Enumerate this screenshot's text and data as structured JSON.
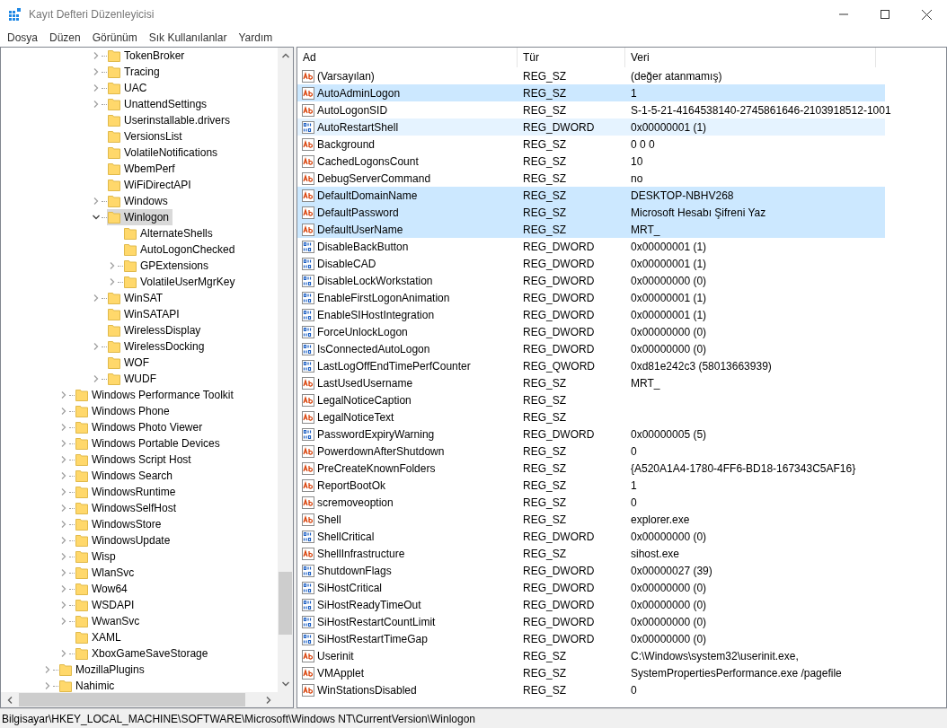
{
  "window": {
    "title": "Kayıt Defteri Düzenleyicisi"
  },
  "menu": [
    "Dosya",
    "Düzen",
    "Görünüm",
    "Sık Kullanılanlar",
    "Yardım"
  ],
  "tree": [
    {
      "children": [
        {
          "children": [
            {
              "children": [
                {
                  "name": "TokenBroker",
                  "expandable": true,
                  "selected": false
                },
                {
                  "name": "Tracing",
                  "expandable": true,
                  "selected": false
                },
                {
                  "name": "UAC",
                  "expandable": true,
                  "selected": false
                },
                {
                  "name": "UnattendSettings",
                  "expandable": true,
                  "selected": false
                },
                {
                  "name": "Userinstallable.drivers",
                  "expandable": false,
                  "selected": false
                },
                {
                  "name": "VersionsList",
                  "expandable": false,
                  "selected": false
                },
                {
                  "name": "VolatileNotifications",
                  "expandable": false,
                  "selected": false
                },
                {
                  "name": "WbemPerf",
                  "expandable": false,
                  "selected": false
                },
                {
                  "name": "WiFiDirectAPI",
                  "expandable": false,
                  "selected": false
                },
                {
                  "name": "Windows",
                  "expandable": true,
                  "selected": false
                },
                {
                  "name": "Winlogon",
                  "expandable": true,
                  "selected": true,
                  "children": [
                    {
                      "name": "AlternateShells",
                      "expandable": false,
                      "selected": false
                    },
                    {
                      "name": "AutoLogonChecked",
                      "expandable": false,
                      "selected": false
                    },
                    {
                      "name": "GPExtensions",
                      "expandable": true,
                      "selected": false
                    },
                    {
                      "name": "VolatileUserMgrKey",
                      "expandable": true,
                      "selected": false
                    }
                  ]
                },
                {
                  "name": "WinSAT",
                  "expandable": true,
                  "selected": false
                },
                {
                  "name": "WinSATAPI",
                  "expandable": false,
                  "selected": false
                },
                {
                  "name": "WirelessDisplay",
                  "expandable": false,
                  "selected": false
                },
                {
                  "name": "WirelessDocking",
                  "expandable": true,
                  "selected": false
                },
                {
                  "name": "WOF",
                  "expandable": false,
                  "selected": false
                },
                {
                  "name": "WUDF",
                  "expandable": true,
                  "selected": false
                }
              ]
            }
          ]
        },
        {
          "name": "Windows Performance Toolkit",
          "expandable": true,
          "selected": false
        },
        {
          "name": "Windows Phone",
          "expandable": true,
          "selected": false
        },
        {
          "name": "Windows Photo Viewer",
          "expandable": true,
          "selected": false
        },
        {
          "name": "Windows Portable Devices",
          "expandable": true,
          "selected": false
        },
        {
          "name": "Windows Script Host",
          "expandable": true,
          "selected": false
        },
        {
          "name": "Windows Search",
          "expandable": true,
          "selected": false
        },
        {
          "name": "WindowsRuntime",
          "expandable": true,
          "selected": false
        },
        {
          "name": "WindowsSelfHost",
          "expandable": true,
          "selected": false
        },
        {
          "name": "WindowsStore",
          "expandable": true,
          "selected": false
        },
        {
          "name": "WindowsUpdate",
          "expandable": true,
          "selected": false
        },
        {
          "name": "Wisp",
          "expandable": true,
          "selected": false
        },
        {
          "name": "WlanSvc",
          "expandable": true,
          "selected": false
        },
        {
          "name": "Wow64",
          "expandable": true,
          "selected": false
        },
        {
          "name": "WSDAPI",
          "expandable": true,
          "selected": false
        },
        {
          "name": "WwanSvc",
          "expandable": true,
          "selected": false
        },
        {
          "name": "XAML",
          "expandable": false,
          "selected": false
        },
        {
          "name": "XboxGameSaveStorage",
          "expandable": true,
          "selected": false
        }
      ]
    },
    {
      "name": "MozillaPlugins",
      "expandable": true,
      "selected": false
    },
    {
      "name": "Nahimic",
      "expandable": true,
      "selected": false
    }
  ],
  "table": {
    "columns": [
      "Ad",
      "Tür",
      "Veri"
    ],
    "rows": [
      {
        "kind": "string",
        "name": "(Varsayılan)",
        "type": "REG_SZ",
        "data": "(değer atanmamış)",
        "selected": false,
        "hovered": false
      },
      {
        "kind": "string",
        "name": "AutoAdminLogon",
        "type": "REG_SZ",
        "data": "1",
        "selected": true,
        "hovered": false
      },
      {
        "kind": "string",
        "name": "AutoLogonSID",
        "type": "REG_SZ",
        "data": "S-1-5-21-4164538140-2745861646-2103918512-1001",
        "selected": false,
        "hovered": false
      },
      {
        "kind": "binary",
        "name": "AutoRestartShell",
        "type": "REG_DWORD",
        "data": "0x00000001 (1)",
        "selected": false,
        "hovered": true
      },
      {
        "kind": "string",
        "name": "Background",
        "type": "REG_SZ",
        "data": "0 0 0",
        "selected": false,
        "hovered": false
      },
      {
        "kind": "string",
        "name": "CachedLogonsCount",
        "type": "REG_SZ",
        "data": "10",
        "selected": false,
        "hovered": false
      },
      {
        "kind": "string",
        "name": "DebugServerCommand",
        "type": "REG_SZ",
        "data": "no",
        "selected": false,
        "hovered": false
      },
      {
        "kind": "string",
        "name": "DefaultDomainName",
        "type": "REG_SZ",
        "data": "DESKTOP-NBHV268",
        "selected": true,
        "hovered": false
      },
      {
        "kind": "string",
        "name": "DefaultPassword",
        "type": "REG_SZ",
        "data": "Microsoft Hesabı Şifreni Yaz",
        "selected": true,
        "hovered": false
      },
      {
        "kind": "string",
        "name": "DefaultUserName",
        "type": "REG_SZ",
        "data": "MRT_",
        "selected": true,
        "hovered": false
      },
      {
        "kind": "binary",
        "name": "DisableBackButton",
        "type": "REG_DWORD",
        "data": "0x00000001 (1)",
        "selected": false,
        "hovered": false
      },
      {
        "kind": "binary",
        "name": "DisableCAD",
        "type": "REG_DWORD",
        "data": "0x00000001 (1)",
        "selected": false,
        "hovered": false
      },
      {
        "kind": "binary",
        "name": "DisableLockWorkstation",
        "type": "REG_DWORD",
        "data": "0x00000000 (0)",
        "selected": false,
        "hovered": false
      },
      {
        "kind": "binary",
        "name": "EnableFirstLogonAnimation",
        "type": "REG_DWORD",
        "data": "0x00000001 (1)",
        "selected": false,
        "hovered": false
      },
      {
        "kind": "binary",
        "name": "EnableSIHostIntegration",
        "type": "REG_DWORD",
        "data": "0x00000001 (1)",
        "selected": false,
        "hovered": false
      },
      {
        "kind": "binary",
        "name": "ForceUnlockLogon",
        "type": "REG_DWORD",
        "data": "0x00000000 (0)",
        "selected": false,
        "hovered": false
      },
      {
        "kind": "binary",
        "name": "IsConnectedAutoLogon",
        "type": "REG_DWORD",
        "data": "0x00000000 (0)",
        "selected": false,
        "hovered": false
      },
      {
        "kind": "binary",
        "name": "LastLogOffEndTimePerfCounter",
        "type": "REG_QWORD",
        "data": "0xd81e242c3 (58013663939)",
        "selected": false,
        "hovered": false
      },
      {
        "kind": "string",
        "name": "LastUsedUsername",
        "type": "REG_SZ",
        "data": "MRT_",
        "selected": false,
        "hovered": false
      },
      {
        "kind": "string",
        "name": "LegalNoticeCaption",
        "type": "REG_SZ",
        "selected": false,
        "hovered": false
      },
      {
        "kind": "string",
        "name": "LegalNoticeText",
        "type": "REG_SZ",
        "selected": false,
        "hovered": false
      },
      {
        "kind": "binary",
        "name": "PasswordExpiryWarning",
        "type": "REG_DWORD",
        "data": "0x00000005 (5)",
        "selected": false,
        "hovered": false
      },
      {
        "kind": "string",
        "name": "PowerdownAfterShutdown",
        "type": "REG_SZ",
        "data": "0",
        "selected": false,
        "hovered": false
      },
      {
        "kind": "string",
        "name": "PreCreateKnownFolders",
        "type": "REG_SZ",
        "data": "{A520A1A4-1780-4FF6-BD18-167343C5AF16}",
        "selected": false,
        "hovered": false
      },
      {
        "kind": "string",
        "name": "ReportBootOk",
        "type": "REG_SZ",
        "data": "1",
        "selected": false,
        "hovered": false
      },
      {
        "kind": "string",
        "name": "scremoveoption",
        "type": "REG_SZ",
        "data": "0",
        "selected": false,
        "hovered": false
      },
      {
        "kind": "string",
        "name": "Shell",
        "type": "REG_SZ",
        "data": "explorer.exe",
        "selected": false,
        "hovered": false
      },
      {
        "kind": "binary",
        "name": "ShellCritical",
        "type": "REG_DWORD",
        "data": "0x00000000 (0)",
        "selected": false,
        "hovered": false
      },
      {
        "kind": "string",
        "name": "ShellInfrastructure",
        "type": "REG_SZ",
        "data": "sihost.exe",
        "selected": false,
        "hovered": false
      },
      {
        "kind": "binary",
        "name": "ShutdownFlags",
        "type": "REG_DWORD",
        "data": "0x00000027 (39)",
        "selected": false,
        "hovered": false
      },
      {
        "kind": "binary",
        "name": "SiHostCritical",
        "type": "REG_DWORD",
        "data": "0x00000000 (0)",
        "selected": false,
        "hovered": false
      },
      {
        "kind": "binary",
        "name": "SiHostReadyTimeOut",
        "type": "REG_DWORD",
        "data": "0x00000000 (0)",
        "selected": false,
        "hovered": false
      },
      {
        "kind": "binary",
        "name": "SiHostRestartCountLimit",
        "type": "REG_DWORD",
        "data": "0x00000000 (0)",
        "selected": false,
        "hovered": false
      },
      {
        "kind": "binary",
        "name": "SiHostRestartTimeGap",
        "type": "REG_DWORD",
        "data": "0x00000000 (0)",
        "selected": false,
        "hovered": false
      },
      {
        "kind": "string",
        "name": "Userinit",
        "type": "REG_SZ",
        "data": "C:\\Windows\\system32\\userinit.exe,",
        "selected": false,
        "hovered": false
      },
      {
        "kind": "string",
        "name": "VMApplet",
        "type": "REG_SZ",
        "data": "SystemPropertiesPerformance.exe /pagefile",
        "selected": false,
        "hovered": false
      },
      {
        "kind": "string",
        "name": "WinStationsDisabled",
        "type": "REG_SZ",
        "data": "0",
        "selected": false,
        "hovered": false
      }
    ]
  },
  "status_bar": "Bilgisayar\\HKEY_LOCAL_MACHINE\\SOFTWARE\\Microsoft\\Windows NT\\CurrentVersion\\Winlogon"
}
